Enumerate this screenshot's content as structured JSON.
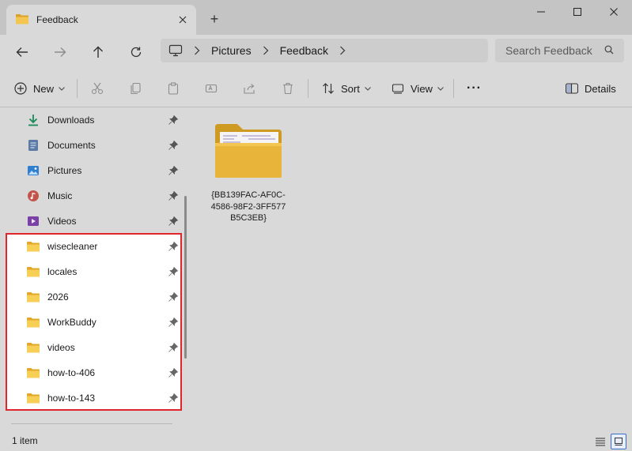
{
  "window": {
    "tab_title": "Feedback",
    "new_tab_symbol": "+"
  },
  "address": {
    "crumbs": [
      "Pictures",
      "Feedback"
    ],
    "search_placeholder": "Search Feedback"
  },
  "toolbar": {
    "new_label": "New",
    "sort_label": "Sort",
    "view_label": "View",
    "more_label": "···",
    "details_label": "Details"
  },
  "sidebar": {
    "quick_access": [
      {
        "label": "Downloads",
        "icon": "downloads-icon"
      },
      {
        "label": "Documents",
        "icon": "documents-icon"
      },
      {
        "label": "Pictures",
        "icon": "pictures-icon"
      },
      {
        "label": "Music",
        "icon": "music-icon"
      },
      {
        "label": "Videos",
        "icon": "videos-icon"
      }
    ],
    "pinned_folders": [
      {
        "label": "wisecleaner"
      },
      {
        "label": "locales"
      },
      {
        "label": "2026"
      },
      {
        "label": "WorkBuddy"
      },
      {
        "label": "videos"
      },
      {
        "label": "how-to-406"
      },
      {
        "label": "how-to-143"
      }
    ]
  },
  "content": {
    "items": [
      {
        "name": "{BB139FAC-AF0C-4586-98F2-3FF577B5C3EB}",
        "icon": "folder-icon"
      }
    ]
  },
  "status": {
    "item_count": "1 item"
  },
  "colors": {
    "highlight_border": "#e0262c",
    "folder_yellow": "#e8b53a",
    "accent": "#3a6ec7"
  }
}
